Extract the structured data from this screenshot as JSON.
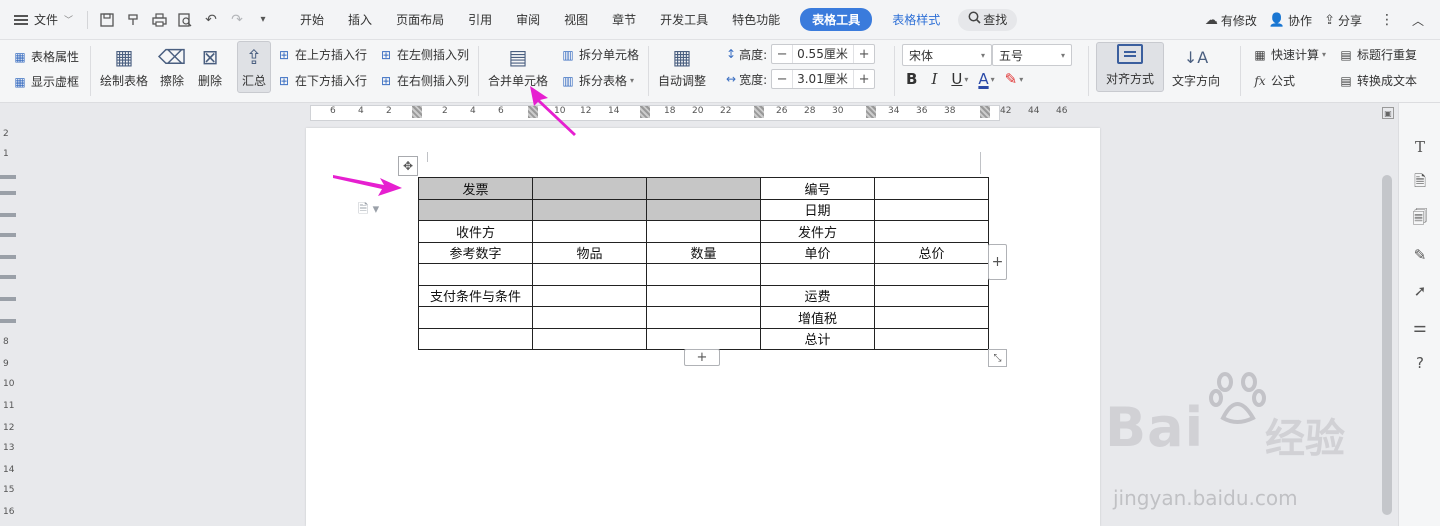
{
  "menubar": {
    "file_label": "文件",
    "tabs": [
      "开始",
      "插入",
      "页面布局",
      "引用",
      "审阅",
      "视图",
      "章节",
      "开发工具",
      "特色功能"
    ],
    "active_tab": "表格工具",
    "style_tab": "表格样式",
    "search_label": "查找",
    "right": {
      "modified": "有修改",
      "collab": "协作",
      "share": "分享"
    }
  },
  "ribbon": {
    "table_props": "表格属性",
    "show_gridlines": "显示虚框",
    "draw_table": "绘制表格",
    "erase": "擦除",
    "delete": "删除",
    "summary": "汇总",
    "insert_above": "在上方插入行",
    "insert_below": "在下方插入行",
    "insert_left": "在左侧插入列",
    "insert_right": "在右侧插入列",
    "merge_cells": "合并单元格",
    "split_cells": "拆分单元格",
    "split_table": "拆分表格",
    "auto_fit": "自动调整",
    "height_label": "高度:",
    "height_value": "0.55厘米",
    "width_label": "宽度:",
    "width_value": "3.01厘米",
    "font_name": "宋体",
    "font_size": "五号",
    "bold": "B",
    "italic": "I",
    "underline": "U",
    "font_color": "A",
    "alignment": "对齐方式",
    "text_direction": "文字方向",
    "quick_calc": "快速计算",
    "repeat_header": "标题行重复",
    "formula": "公式",
    "to_text": "转换成文本"
  },
  "ruler": {
    "ticks": [
      "6",
      "4",
      "2",
      "2",
      "4",
      "6",
      "10",
      "12",
      "14",
      "18",
      "20",
      "22",
      "26",
      "28",
      "30",
      "34",
      "36",
      "38",
      "42",
      "44",
      "46"
    ],
    "vticks": [
      "2",
      "1",
      "8",
      "9",
      "10",
      "11",
      "12",
      "13",
      "14",
      "15",
      "16"
    ]
  },
  "table": {
    "rows": [
      [
        "发票",
        "",
        "",
        "编号",
        ""
      ],
      [
        "",
        "",
        "",
        "日期",
        ""
      ],
      [
        "收件方",
        "",
        "",
        "发件方",
        ""
      ],
      [
        "参考数字",
        "物品",
        "数量",
        "单价",
        "总价"
      ],
      [
        "",
        "",
        "",
        "",
        ""
      ],
      [
        "支付条件与条件",
        "",
        "",
        "运费",
        ""
      ],
      [
        "",
        "",
        "",
        "增值税",
        ""
      ],
      [
        "",
        "",
        "",
        "总计",
        ""
      ]
    ],
    "shaded_cells": [
      [
        0,
        0
      ],
      [
        0,
        1
      ],
      [
        0,
        2
      ],
      [
        1,
        0
      ],
      [
        1,
        1
      ],
      [
        1,
        2
      ]
    ]
  },
  "watermark": {
    "brand": "Bai",
    "brand_tail": "经验",
    "url": "jingyan.baidu.com"
  },
  "colors": {
    "accent": "#3a7bdc",
    "arrow": "#e61fd0",
    "shade": "#c6c6c6"
  }
}
